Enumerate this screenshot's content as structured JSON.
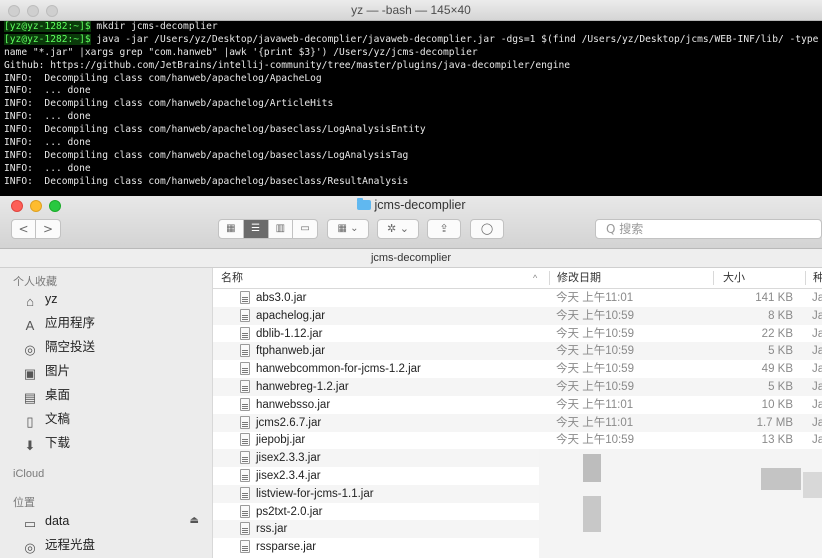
{
  "terminal": {
    "title": "yz — -bash — 145×40",
    "lines": [
      {
        "prompt": "[yz@yz-1282:~]$",
        "text": " mkdir jcms-decomplier"
      },
      {
        "prompt": "[yz@yz-1282:~]$",
        "text": " java -jar /Users/yz/Desktop/javaweb-decomplier/javaweb-decomplier.jar -dgs=1 $(find /Users/yz/Desktop/jcms/WEB-INF/lib/ -type f -"
      },
      {
        "prompt": "",
        "text": "name \"*.jar\" |xargs grep \"com.hanweb\" |awk '{print $3}') /Users/yz/jcms-decomplier"
      },
      {
        "prompt": "",
        "text": "Github: https://github.com/JetBrains/intellij-community/tree/master/plugins/java-decompiler/engine"
      },
      {
        "prompt": "",
        "text": "INFO:  Decompiling class com/hanweb/apachelog/ApacheLog"
      },
      {
        "prompt": "",
        "text": "INFO:  ... done"
      },
      {
        "prompt": "",
        "text": "INFO:  Decompiling class com/hanweb/apachelog/ArticleHits"
      },
      {
        "prompt": "",
        "text": "INFO:  ... done"
      },
      {
        "prompt": "",
        "text": "INFO:  Decompiling class com/hanweb/apachelog/baseclass/LogAnalysisEntity"
      },
      {
        "prompt": "",
        "text": "INFO:  ... done"
      },
      {
        "prompt": "",
        "text": "INFO:  Decompiling class com/hanweb/apachelog/baseclass/LogAnalysisTag"
      },
      {
        "prompt": "",
        "text": "INFO:  ... done"
      },
      {
        "prompt": "",
        "text": "INFO:  Decompiling class com/hanweb/apachelog/baseclass/ResultAnalysis"
      }
    ]
  },
  "finder": {
    "title": "jcms-decomplier",
    "path": "jcms-decomplier",
    "toolbar": {
      "back": "<",
      "forward": ">",
      "views": [
        "▦",
        "☰",
        "▥",
        "▭"
      ],
      "arrange": "▦ ⌄",
      "action": "✲ ⌄",
      "share": "⇪",
      "tag": "◯",
      "search_placeholder": "Q 搜索"
    },
    "sidebar": {
      "favorites_header": "个人收藏",
      "favorites": [
        {
          "label": "yz",
          "icon": "home-icon",
          "glyph": "⌂"
        },
        {
          "label": "应用程序",
          "icon": "applications-icon",
          "glyph": "A"
        },
        {
          "label": "隔空投送",
          "icon": "airdrop-icon",
          "glyph": "◎"
        },
        {
          "label": "图片",
          "icon": "camera-icon",
          "glyph": "▣"
        },
        {
          "label": "桌面",
          "icon": "desktop-icon",
          "glyph": "▤"
        },
        {
          "label": "文稿",
          "icon": "documents-icon",
          "glyph": "▯"
        },
        {
          "label": "下载",
          "icon": "download-icon",
          "glyph": "⬇"
        }
      ],
      "icloud_header": "iCloud",
      "locations_header": "位置",
      "locations": [
        {
          "label": "data",
          "icon": "disk-icon",
          "glyph": "▭",
          "eject": "⏏"
        },
        {
          "label": "远程光盘",
          "icon": "remote-disc-icon",
          "glyph": "◎"
        }
      ]
    },
    "columns": {
      "name": "名称",
      "sort_indicator": "^",
      "date": "修改日期",
      "size": "大小",
      "kind": "种"
    },
    "files": [
      {
        "name": "abs3.0.jar",
        "date": "今天 上午11:01",
        "size": "141 KB",
        "kind": "Ja"
      },
      {
        "name": "apachelog.jar",
        "date": "今天 上午10:59",
        "size": "8 KB",
        "kind": "Ja"
      },
      {
        "name": "dblib-1.12.jar",
        "date": "今天 上午10:59",
        "size": "22 KB",
        "kind": "Ja"
      },
      {
        "name": "ftphanweb.jar",
        "date": "今天 上午10:59",
        "size": "5 KB",
        "kind": "Ja"
      },
      {
        "name": "hanwebcommon-for-jcms-1.2.jar",
        "date": "今天 上午10:59",
        "size": "49 KB",
        "kind": "Ja"
      },
      {
        "name": "hanwebreg-1.2.jar",
        "date": "今天 上午10:59",
        "size": "5 KB",
        "kind": "Ja"
      },
      {
        "name": "hanwebsso.jar",
        "date": "今天 上午11:01",
        "size": "10 KB",
        "kind": "Ja"
      },
      {
        "name": "jcms2.6.7.jar",
        "date": "今天 上午11:01",
        "size": "1.7 MB",
        "kind": "Ja"
      },
      {
        "name": "jiepobj.jar",
        "date": "今天 上午10:59",
        "size": "13 KB",
        "kind": "Ja"
      },
      {
        "name": "jisex2.3.3.jar",
        "date": "",
        "size": "",
        "kind": ""
      },
      {
        "name": "jisex2.3.4.jar",
        "date": "",
        "size": "",
        "kind": ""
      },
      {
        "name": "listview-for-jcms-1.1.jar",
        "date": "",
        "size": "",
        "kind": ""
      },
      {
        "name": "ps2txt-2.0.jar",
        "date": "",
        "size": "",
        "kind": ""
      },
      {
        "name": "rss.jar",
        "date": "",
        "size": "",
        "kind": ""
      },
      {
        "name": "rssparse.jar",
        "date": "",
        "size": "",
        "kind": ""
      }
    ]
  }
}
